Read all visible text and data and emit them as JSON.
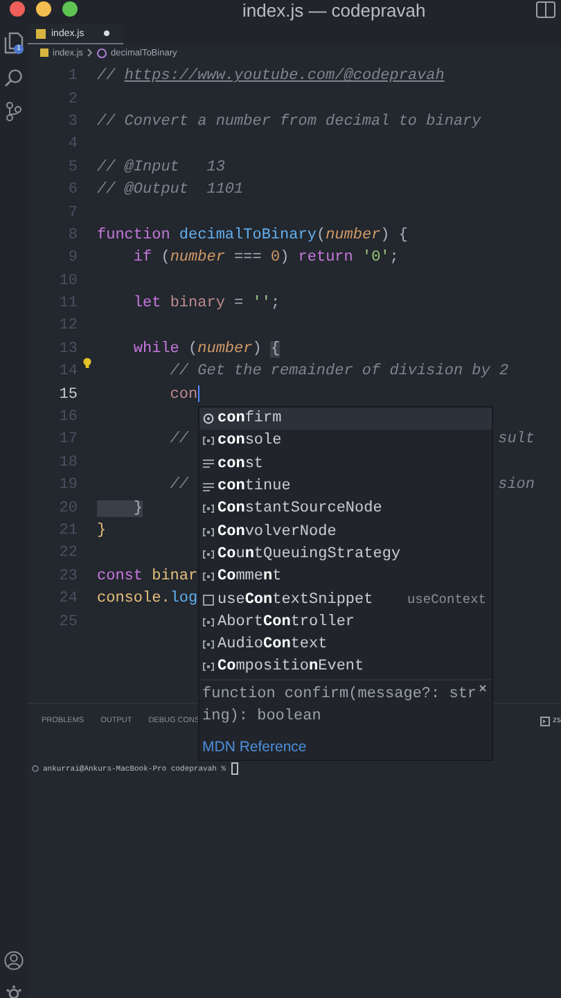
{
  "window": {
    "title": "index.js — codepravah"
  },
  "activity_bar": {
    "explorer_badge": "1"
  },
  "tabs": [
    {
      "label": "index.js",
      "selected": true,
      "modified": true
    }
  ],
  "breadcrumbs": [
    "index.js",
    "decimalToBinary"
  ],
  "code": [
    {
      "n": "1",
      "current": false,
      "tokens": [
        {
          "kind": "comment",
          "t": "// "
        },
        {
          "kind": "link",
          "t": "https://www.youtube.com/@codepravah"
        }
      ]
    },
    {
      "n": "2",
      "current": false
    },
    {
      "n": "3",
      "current": false,
      "tokens": [
        {
          "kind": "comment",
          "t": "// Convert a number from decimal to binary"
        }
      ]
    },
    {
      "n": "4",
      "current": false
    },
    {
      "n": "5",
      "current": false,
      "tokens": [
        {
          "kind": "comment",
          "t": "// @Input   13"
        }
      ]
    },
    {
      "n": "6",
      "current": false,
      "tokens": [
        {
          "kind": "comment",
          "t": "// @Output  1101"
        }
      ]
    },
    {
      "n": "7",
      "current": false
    },
    {
      "n": "8",
      "current": false,
      "tokens": [
        {
          "kind": "keyword",
          "t": "function "
        },
        {
          "kind": "function",
          "t": "decimalToBinary"
        },
        {
          "kind": "punct",
          "t": "("
        },
        {
          "kind": "param",
          "t": "number"
        },
        {
          "kind": "punct",
          "t": ") {"
        }
      ]
    },
    {
      "n": "9",
      "current": false,
      "tokens": [
        {
          "kind": "keyword",
          "t": "    if "
        },
        {
          "kind": "punct",
          "t": "("
        },
        {
          "kind": "param",
          "t": "number"
        },
        {
          "kind": "punct",
          "t": " === "
        },
        {
          "kind": "number",
          "t": "0"
        },
        {
          "kind": "punct",
          "t": ") "
        },
        {
          "kind": "keyword",
          "t": "return "
        },
        {
          "kind": "string",
          "t": "'0'"
        },
        {
          "kind": "punct",
          "t": ";"
        }
      ]
    },
    {
      "n": "10",
      "current": false
    },
    {
      "n": "11",
      "current": false,
      "tokens": [
        {
          "kind": "keyword",
          "t": "    let "
        },
        {
          "kind": "variable",
          "t": "binary"
        },
        {
          "kind": "punct",
          "t": " = "
        },
        {
          "kind": "string",
          "t": "''"
        },
        {
          "kind": "punct",
          "t": ";"
        }
      ]
    },
    {
      "n": "12",
      "current": false
    },
    {
      "n": "13",
      "current": false,
      "tokens": [
        {
          "kind": "keyword",
          "t": "    while "
        },
        {
          "kind": "punct",
          "t": "("
        },
        {
          "kind": "param",
          "t": "number"
        },
        {
          "kind": "punct",
          "t": ") "
        },
        {
          "kind": "bracket",
          "t": "{"
        }
      ]
    },
    {
      "n": "14",
      "current": false,
      "lightbulb": true,
      "tokens": [
        {
          "kind": "comment",
          "t": "        // Get the remainder of division by 2"
        }
      ]
    },
    {
      "n": "15",
      "current": true,
      "cursor": true,
      "tokens": [
        {
          "kind": "variable",
          "t": "        con"
        }
      ]
    },
    {
      "n": "16",
      "current": false
    },
    {
      "n": "17",
      "current": false,
      "tokens": [
        {
          "kind": "comment",
          "t": "        // "
        }
      ],
      "tail": "sult"
    },
    {
      "n": "18",
      "current": false
    },
    {
      "n": "19",
      "current": false,
      "tokens": [
        {
          "kind": "comment",
          "t": "        // "
        }
      ],
      "tail": "sion"
    },
    {
      "n": "20",
      "current": false,
      "tokens": [
        {
          "kind": "bracket",
          "t": "    }"
        }
      ]
    },
    {
      "n": "21",
      "current": false,
      "tokens": [
        {
          "kind": "object",
          "t": "}"
        }
      ]
    },
    {
      "n": "22",
      "current": false
    },
    {
      "n": "23",
      "current": false,
      "tokens": [
        {
          "kind": "keyword",
          "t": "const "
        },
        {
          "kind": "object",
          "t": "binar"
        }
      ]
    },
    {
      "n": "24",
      "current": false,
      "tokens": [
        {
          "kind": "object",
          "t": "console."
        },
        {
          "kind": "function",
          "t": "log"
        }
      ]
    },
    {
      "n": "25",
      "current": false
    }
  ],
  "suggestions": [
    {
      "kind": "method",
      "label": "**con**firm",
      "selected": true
    },
    {
      "kind": "variable",
      "label": "**con**sole",
      "selected": false
    },
    {
      "kind": "keyword",
      "label": "**con**st",
      "selected": false
    },
    {
      "kind": "keyword",
      "label": "**con**tinue",
      "selected": false
    },
    {
      "kind": "variable",
      "label": "**Con**stantSourceNode",
      "selected": false
    },
    {
      "kind": "variable",
      "label": "**Con**volverNode",
      "selected": false
    },
    {
      "kind": "variable",
      "label": "**Co**u**n**tQueuingStrategy",
      "selected": false
    },
    {
      "kind": "variable",
      "label": "**Co**mme**n**t",
      "selected": false
    },
    {
      "kind": "snippet",
      "label": "use**Con**textSnippet",
      "detail": "useContext",
      "selected": false
    },
    {
      "kind": "variable",
      "label": "Abort**Con**troller",
      "selected": false
    },
    {
      "kind": "variable",
      "label": "Audio**Con**text",
      "selected": false
    },
    {
      "kind": "variable",
      "label": "**Co**mpositio**n**Event",
      "selected": false
    }
  ],
  "suggestion_details": {
    "signature": "function confirm(message?: string): boolean",
    "link": "MDN Reference"
  },
  "panel": {
    "tabs": [
      {
        "label": "PROBLEMS",
        "selected": false
      },
      {
        "label": "OUTPUT",
        "selected": false
      },
      {
        "label": "DEBUG CONS",
        "selected": false
      }
    ],
    "shell": "zs",
    "terminal_line": "ankurrai@Ankurs-MacBook-Pro codepravah % "
  }
}
